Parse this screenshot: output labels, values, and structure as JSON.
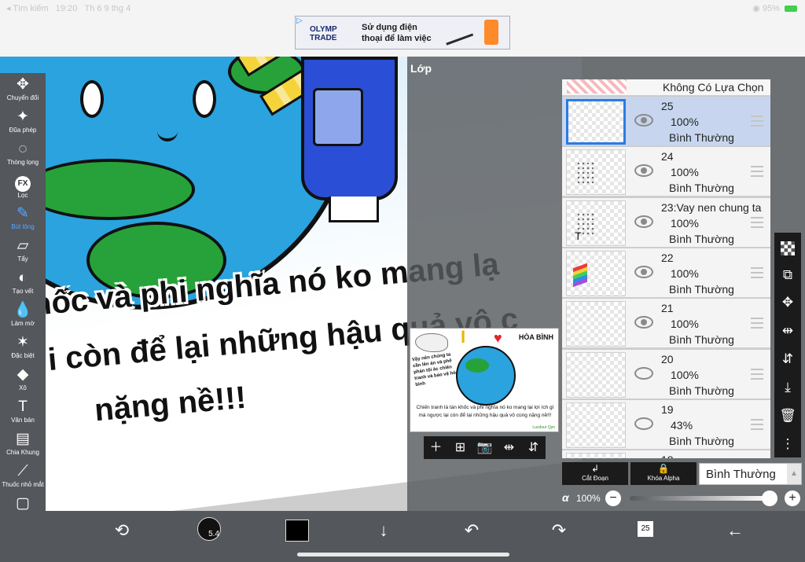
{
  "status": {
    "back_label": "◂ Tìm kiếm",
    "time": "19:20",
    "date": "Th 6 9 thg 4",
    "battery": "95%"
  },
  "ad": {
    "brand_line1": "OLYMP",
    "brand_line2": "TRADE",
    "text_line1": "Sử dụng điện",
    "text_line2": "thoại để làm việc"
  },
  "canvas": {
    "line1": "hốc và phi nghĩa nó ko mang lạ",
    "line2": "i còn để lại những hậu quả vô c",
    "line3": "nặng nề!!!"
  },
  "toolbar": [
    {
      "icon": "✥",
      "label": "Chuyển đổi",
      "name": "transform-tool"
    },
    {
      "icon": "✦",
      "label": "Đũa phép",
      "name": "magic-wand-tool"
    },
    {
      "icon": "◌",
      "label": "Thòng lọng",
      "name": "lasso-tool"
    },
    {
      "icon": "FX",
      "label": "Lọc",
      "name": "filter-tool"
    },
    {
      "icon": "✎",
      "label": "Bút lông",
      "name": "brush-tool",
      "active": true
    },
    {
      "icon": "▱",
      "label": "Tẩy",
      "name": "eraser-tool"
    },
    {
      "icon": "◐",
      "label": "Tạo vết",
      "name": "smudge-tool"
    },
    {
      "icon": "💧",
      "label": "Làm mờ",
      "name": "blur-tool"
    },
    {
      "icon": "✶",
      "label": "Đặc biệt",
      "name": "special-tool"
    },
    {
      "icon": "◆",
      "label": "Xô",
      "name": "bucket-tool"
    },
    {
      "icon": "T",
      "label": "Văn bản",
      "name": "text-tool"
    },
    {
      "icon": "▤",
      "label": "Chia Khung",
      "name": "frame-divider-tool"
    },
    {
      "icon": "⟋",
      "label": "Thuốc nhỏ mắt",
      "name": "eyedropper-tool"
    },
    {
      "icon": "▢",
      "label": "Tấm vải",
      "name": "canvas-tool"
    }
  ],
  "layer_panel": {
    "title": "Lớp",
    "no_selection": "Không Có Lựa Chọn",
    "layers": [
      {
        "name": "25",
        "opacity": "100%",
        "blend": "Bình Thường",
        "selected": true,
        "visible": true,
        "thumb": "blank"
      },
      {
        "name": "24",
        "opacity": "100%",
        "blend": "Bình Thường",
        "selected": false,
        "visible": true,
        "thumb": "dots"
      },
      {
        "name": "23:Vay nen chung ta",
        "opacity": "100%",
        "blend": "Bình Thường",
        "selected": false,
        "visible": true,
        "thumb": "text"
      },
      {
        "name": "22",
        "opacity": "100%",
        "blend": "Bình Thường",
        "selected": false,
        "visible": true,
        "thumb": "rainbow"
      },
      {
        "name": "21",
        "opacity": "100%",
        "blend": "Bình Thường",
        "selected": false,
        "visible": true,
        "thumb": "blank"
      },
      {
        "name": "20",
        "opacity": "100%",
        "blend": "Bình Thường",
        "selected": false,
        "visible": false,
        "thumb": "blank"
      },
      {
        "name": "19",
        "opacity": "43%",
        "blend": "Bình Thường",
        "selected": false,
        "visible": false,
        "thumb": "blank"
      },
      {
        "name": "18",
        "opacity": "",
        "blend": "",
        "selected": false,
        "visible": false,
        "thumb": "blank"
      }
    ],
    "clip_label": "Cắt Đoạn",
    "alpha_lock_label": "Khóa Alpha",
    "blend_mode": "Bình Thường",
    "alpha_symbol": "α",
    "opacity_value": "100%"
  },
  "preview": {
    "peace": "HÒA BÌNH",
    "slogan": "Vậy nên chúng ta cần lên án và phê phán tội ác chiến tranh và bảo vệ hòa bình",
    "caption": "Chiến tranh là tàn khốc và phi nghĩa nó ko mang lại lợi ích gì mà ngược lại còn để lại những hậu quả vô cùng nặng nề!!!",
    "letter_i": "I",
    "signature": "Lucdour Qyn"
  },
  "bottom": {
    "brush_size": "5.4",
    "layer_count": "25"
  },
  "colors": {
    "accent": "#2c7be0",
    "active_tool": "#5aa7ff",
    "toolbar_bg": "#54575b",
    "current_color": "#000000"
  }
}
